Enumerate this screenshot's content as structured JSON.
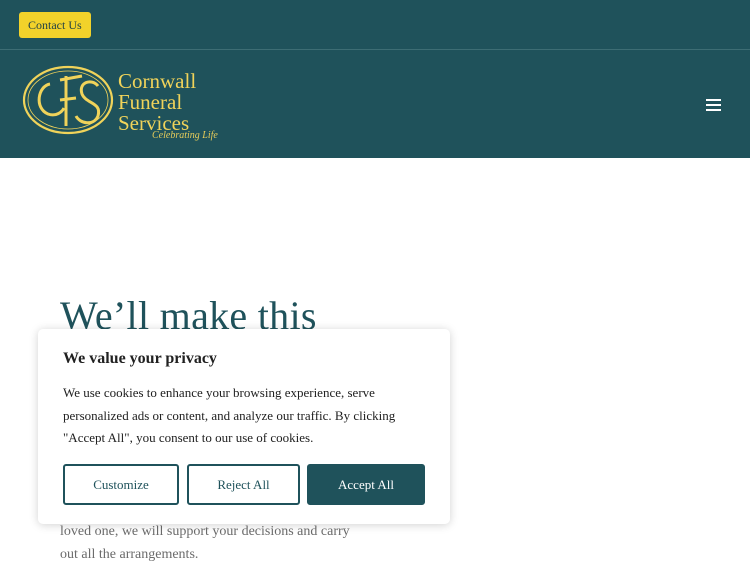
{
  "topbar": {
    "contact_label": "Contact Us"
  },
  "header": {
    "logo": {
      "monogram": "CFS",
      "line1": "Cornwall",
      "line2": "Funeral",
      "line3": "Services",
      "tagline": "Celebrating Life"
    },
    "menu_icon": "hamburger-menu-icon"
  },
  "hero": {
    "heading": "We’ll make this",
    "body": "loved one, we will support your decisions and carry out all the arrangements."
  },
  "cookie_banner": {
    "title": "We value your privacy",
    "text": "We use cookies to enhance your browsing experience, serve personalized ads or content, and analyze our traffic. By clicking \"Accept All\", you consent to our use of cookies.",
    "customize_label": "Customize",
    "reject_label": "Reject All",
    "accept_label": "Accept All"
  },
  "colors": {
    "brand_teal": "#1f525b",
    "accent_yellow": "#f2d22a",
    "logo_gold": "#f0d35a"
  }
}
